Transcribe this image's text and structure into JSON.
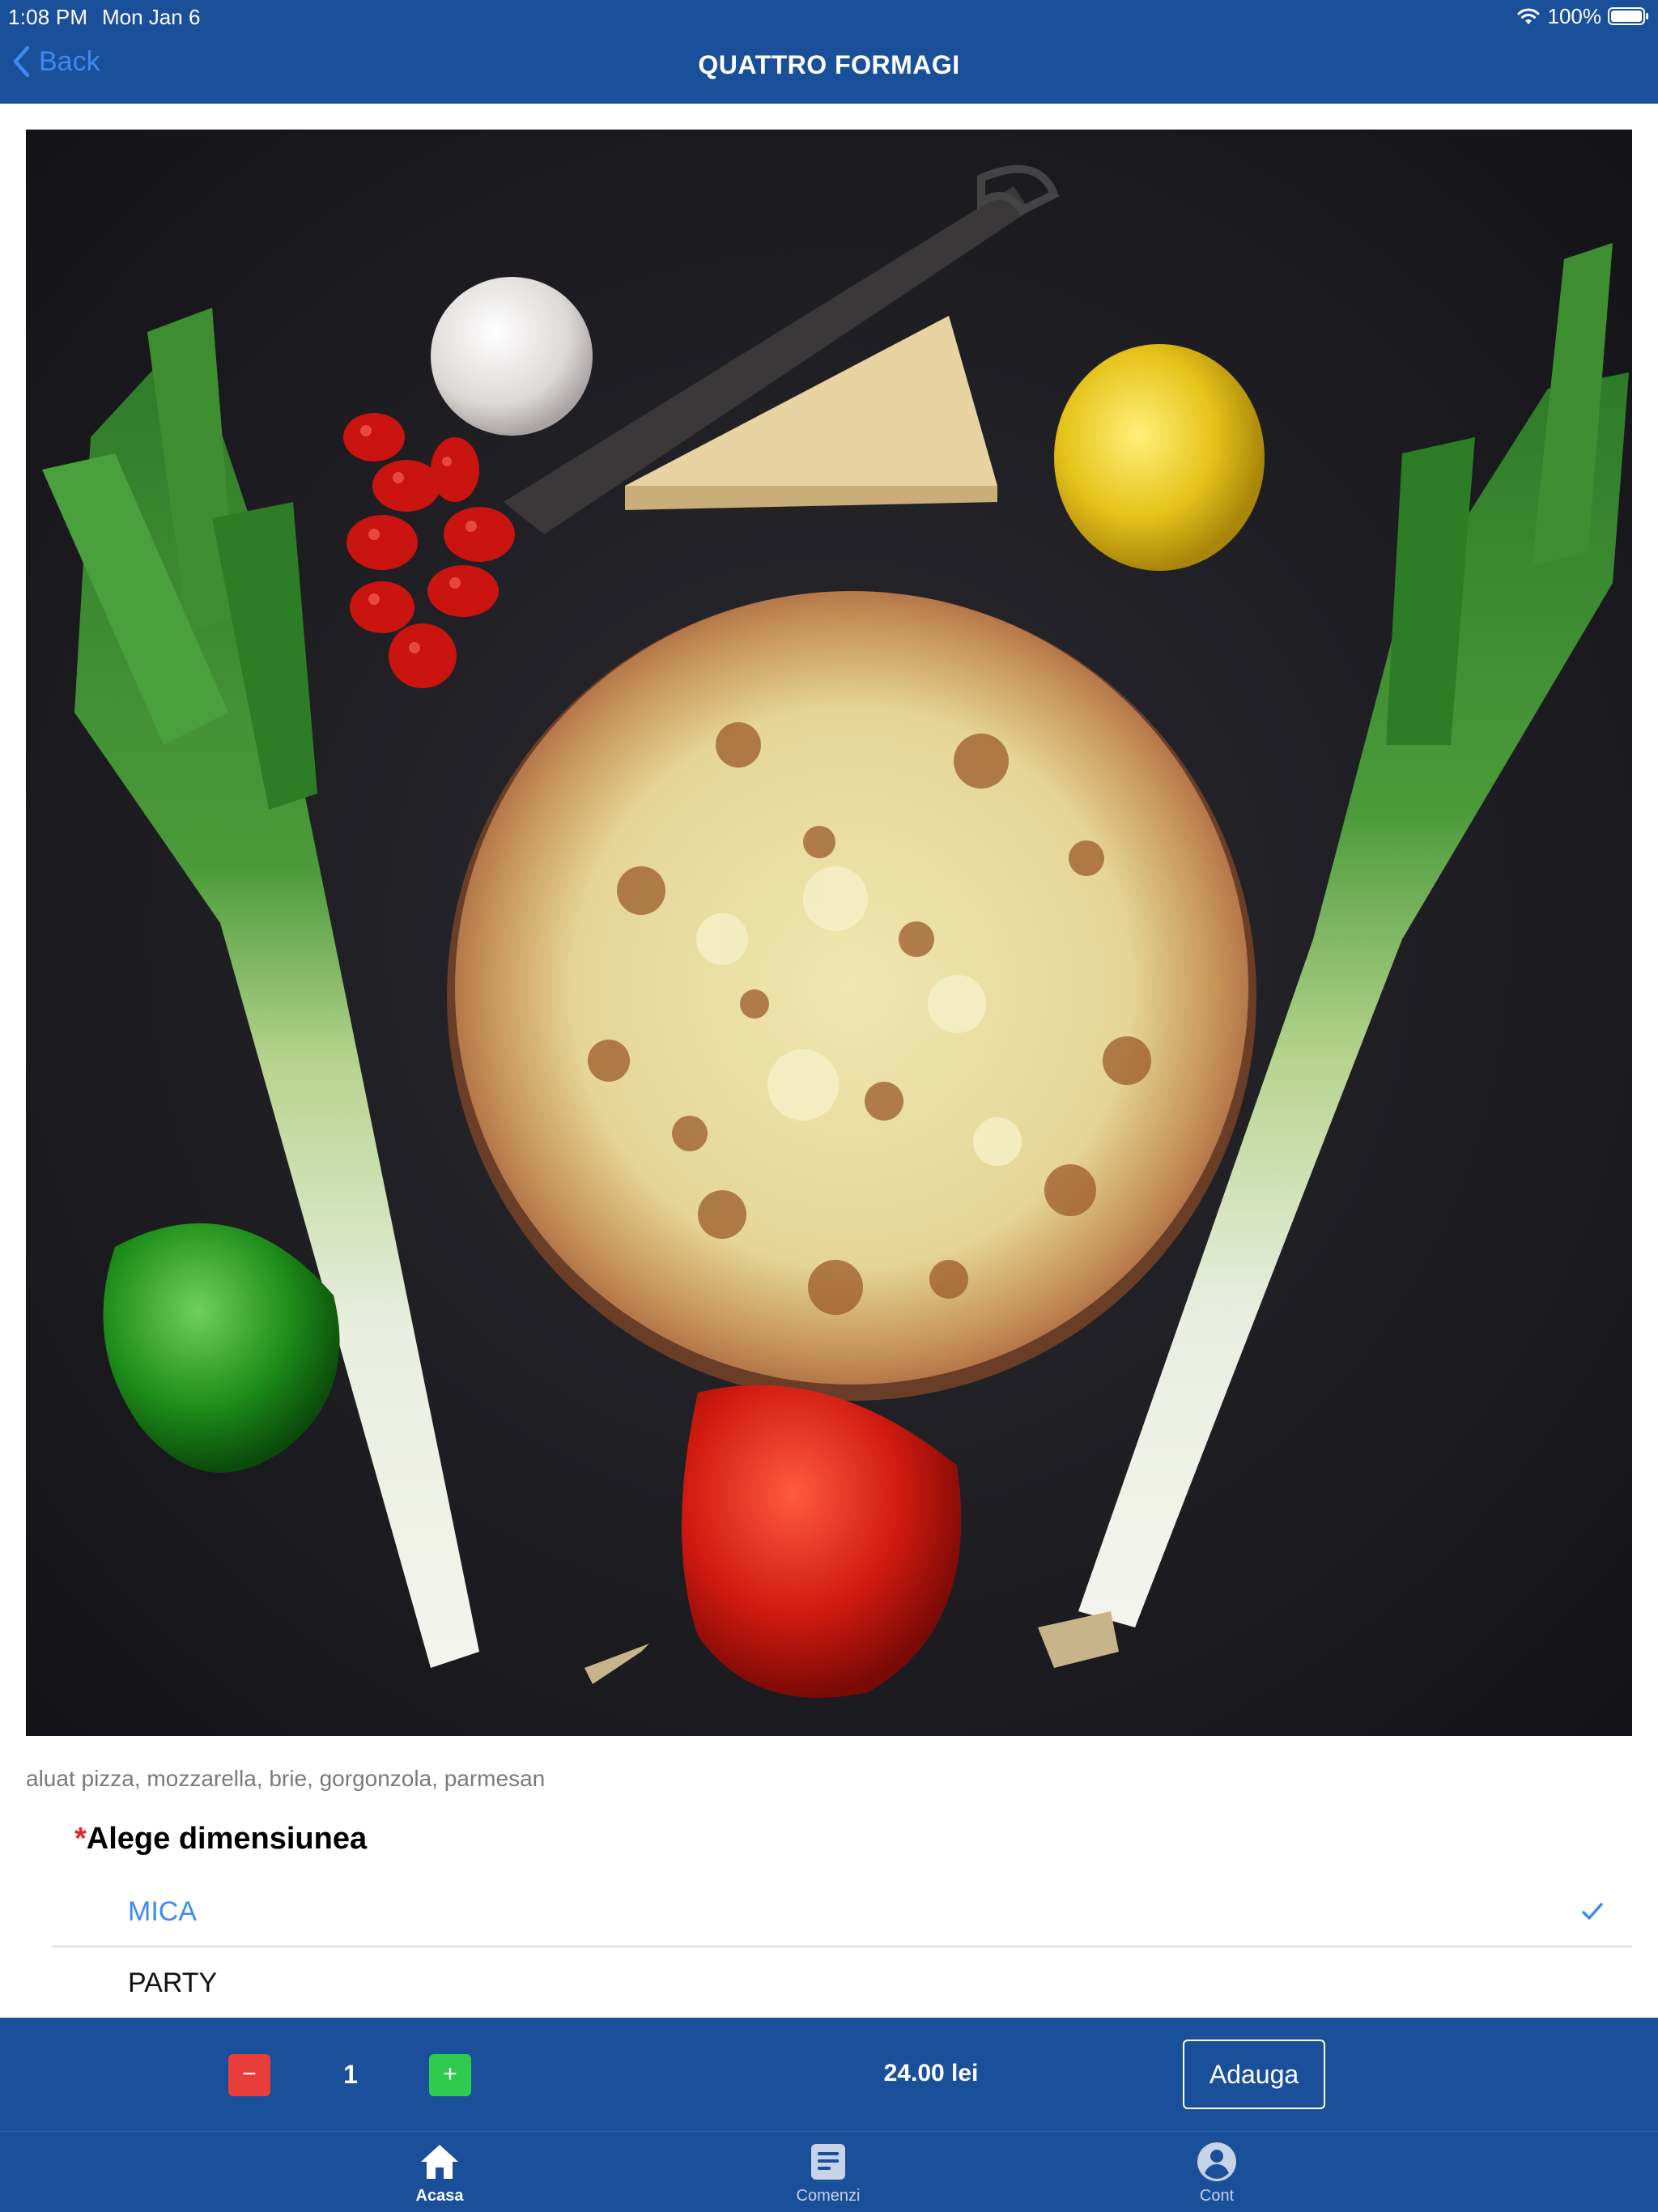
{
  "status_bar": {
    "time": "1:08 PM",
    "date": "Mon Jan 6",
    "battery": "100%"
  },
  "nav": {
    "back_label": "Back",
    "title": "QUATTRO FORMAGI"
  },
  "product": {
    "image_icon": "pizza-photo",
    "ingredients": "aluat pizza, mozzarella, brie, gorgonzola, parmesan"
  },
  "size_selector": {
    "required_mark": "*",
    "title": "Alege dimensiunea",
    "options": [
      {
        "label": "MICA",
        "selected": true
      },
      {
        "label": "PARTY",
        "selected": false
      }
    ]
  },
  "action_bar": {
    "minus_label": "−",
    "quantity": "1",
    "plus_label": "+",
    "price": "24.00 lei",
    "add_label": "Adauga"
  },
  "tab_bar": {
    "tabs": [
      {
        "label": "Acasa",
        "icon": "home-icon",
        "active": true
      },
      {
        "label": "Comenzi",
        "icon": "orders-icon",
        "active": false
      },
      {
        "label": "Cont",
        "icon": "account-icon",
        "active": false
      }
    ]
  },
  "colors": {
    "brand_blue": "#1a4f9a",
    "link_blue": "#3d8bf0",
    "minus_red": "#e93e3a",
    "plus_green": "#2ecb4f"
  }
}
